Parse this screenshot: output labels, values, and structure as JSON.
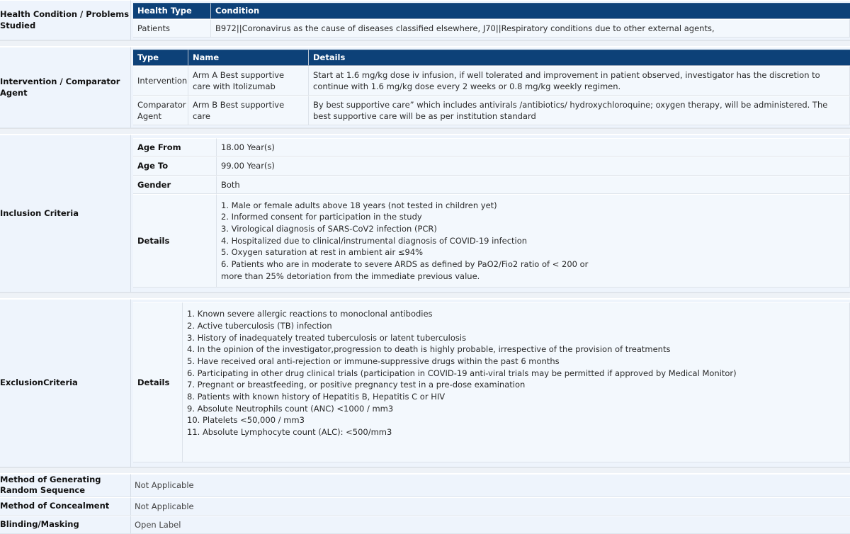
{
  "sections": {
    "health_condition": {
      "label": "Health Condition / Problems Studied",
      "headers": [
        "Health Type",
        "Condition"
      ],
      "rows": [
        {
          "health_type": "Patients",
          "condition": "B972||Coronavirus as the cause of diseases classified elsewhere, J70||Respiratory conditions due to other external agents,"
        }
      ]
    },
    "intervention": {
      "label": "Intervention / Comparator Agent",
      "headers": [
        "Type",
        "Name",
        "Details"
      ],
      "rows": [
        {
          "type": "Intervention",
          "name": "Arm A Best supportive care with Itolizumab",
          "details": "Start at 1.6 mg/kg dose iv infusion, if well tolerated and improvement in patient observed, investigator has the discretion to continue with 1.6 mg/kg dose every 2 weeks or 0.8 mg/kg weekly regimen."
        },
        {
          "type": "Comparator Agent",
          "name": "Arm B Best supportive care",
          "details": "By best supportive care” which includes antivirals /antibiotics/ hydroxychloroquine; oxygen therapy, will be administered. The best supportive care will be as per institution standard"
        }
      ]
    },
    "inclusion": {
      "label": "Inclusion Criteria",
      "age_from_label": "Age From",
      "age_from_value": "18.00 Year(s)",
      "age_to_label": "Age To",
      "age_to_value": "99.00 Year(s)",
      "gender_label": "Gender",
      "gender_value": "Both",
      "details_label": "Details",
      "details_items": [
        "1. Male or female adults above 18 years (not tested in children yet)",
        "2. Informed consent for participation in the study",
        "3. Virological diagnosis of SARS-CoV2 infection (PCR)",
        "4. Hospitalized due to clinical/instrumental diagnosis of COVID-19 infection",
        "5. Oxygen saturation at rest in ambient air ≤94%",
        "6. Patients who are in moderate to severe ARDS as defined by PaO2/Fio2 ratio of < 200 or",
        "more than 25% detoriation from the immediate previous value."
      ]
    },
    "exclusion": {
      "label": "ExclusionCriteria",
      "details_label": "Details",
      "details_items": [
        "1. Known severe allergic reactions to monoclonal antibodies",
        "2. Active tuberculosis (TB) infection",
        "3. History of inadequately treated tuberculosis or latent tuberculosis",
        "4. In the opinion of the investigator,progression to death is highly probable, irrespective of the provision of treatments",
        "5. Have received oral anti-rejection or immune-suppressive drugs within the past 6 months",
        "6. Participating in other drug clinical trials (participation in COVID-19 anti-viral trials may be permitted if approved by Medical Monitor)",
        "7. Pregnant or breastfeeding, or positive pregnancy test in a pre-dose examination",
        "8. Patients with known history of Hepatitis B, Hepatitis C or HIV",
        "9. Absolute Neutrophils count (ANC) <1000 / mm3",
        "10. Platelets <50,000 / mm3",
        "11. Absolute Lymphocyte count (ALC): <500/mm3"
      ]
    },
    "random_sequence": {
      "label": "Method of Generating Random Sequence",
      "value": "Not Applicable"
    },
    "concealment": {
      "label": "Method of Concealment",
      "value": "Not Applicable"
    },
    "blinding": {
      "label": "Blinding/Masking",
      "value": "Open Label"
    }
  },
  "colors": {
    "header_navy": "#0d4178",
    "page_background": "#eef4fc",
    "cell_background": "#f3f8fd"
  }
}
